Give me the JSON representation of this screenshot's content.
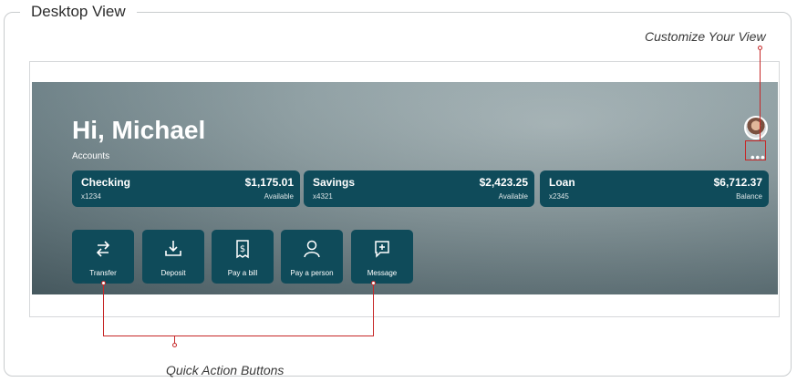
{
  "frame_title": "Desktop View",
  "callouts": {
    "customize": "Customize Your View",
    "quick_actions": "Quick Action Buttons"
  },
  "hero": {
    "greeting": "Hi, Michael",
    "accounts_label": "Accounts",
    "more_label": "•••"
  },
  "accounts": [
    {
      "name": "Checking",
      "number": "x1234",
      "amount": "$1,175.01",
      "status": "Available"
    },
    {
      "name": "Savings",
      "number": "x4321",
      "amount": "$2,423.25",
      "status": "Available"
    },
    {
      "name": "Loan",
      "number": "x2345",
      "amount": "$6,712.37",
      "status": "Balance"
    }
  ],
  "quick_actions": [
    {
      "label": "Transfer",
      "icon": "transfer-arrows-icon"
    },
    {
      "label": "Deposit",
      "icon": "download-deposit-icon"
    },
    {
      "label": "Pay a bill",
      "icon": "bill-receipt-icon"
    },
    {
      "label": "Pay a person",
      "icon": "person-icon"
    },
    {
      "label": "Message",
      "icon": "message-icon"
    }
  ],
  "colors": {
    "card": "#0f4b5a",
    "callout_line": "#c62828"
  }
}
